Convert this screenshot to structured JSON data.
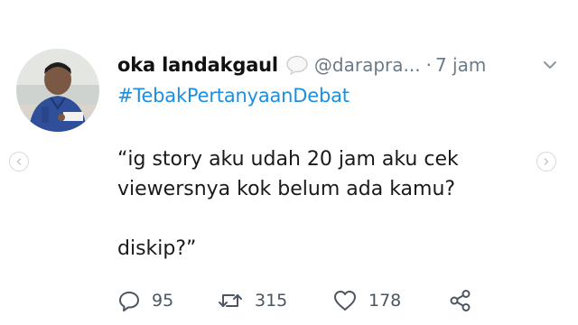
{
  "tweet": {
    "display_name": "oka landakgaul",
    "handle": "@darapra...",
    "separator": "·",
    "time": "7 jam",
    "hashtag": "#TebakPertanyaanDebat",
    "lines": [
      "“ig story aku udah 20 jam aku cek",
      "viewersnya kok belum ada kamu?",
      "diskip?”"
    ]
  },
  "actions": {
    "reply_count": "95",
    "retweet_count": "315",
    "like_count": "178"
  },
  "icons": {
    "reply": "reply-icon",
    "retweet": "retweet-icon",
    "like": "heart-icon",
    "share": "share-icon",
    "more": "chevron-down-icon",
    "nav_prev": "chevron-left-icon",
    "nav_next": "chevron-right-icon"
  },
  "colors": {
    "hashtag": "#1d8ee0",
    "meta": "#6b7a86",
    "text": "#1a1a1a"
  }
}
